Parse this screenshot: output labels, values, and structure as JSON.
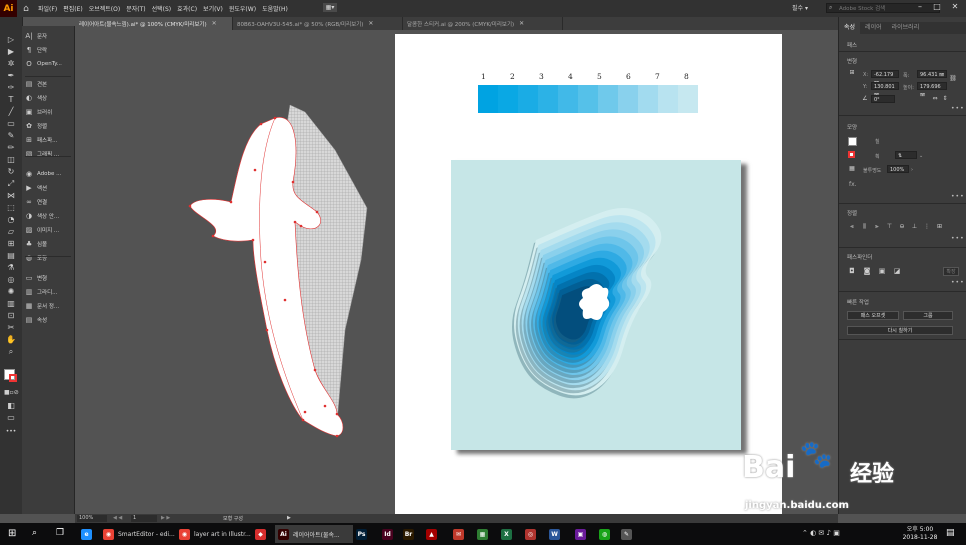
{
  "menubar": {
    "logo": "Ai",
    "items": [
      "파일(F)",
      "편집(E)",
      "오브젝트(O)",
      "문자(T)",
      "선택(S)",
      "효과(C)",
      "보기(V)",
      "윈도우(W)",
      "도움말(H)"
    ],
    "workspace_icon": "▦▾",
    "essentials": "필수 ▾",
    "search_placeholder": "Adobe Stock 검색",
    "window_buttons": [
      "–",
      "□",
      "✕"
    ]
  },
  "tabs": [
    {
      "label": "레이어아트(물속느낌).ai* @ 100% (CMYK/미리보기)",
      "active": true
    },
    {
      "label": "80B63-OAHV3U-545.ai* @ 50% (RGB/미리보기)",
      "active": false
    },
    {
      "label": "달콤한 스티커.ai @ 200% (CMYK/미리보기)",
      "active": false
    }
  ],
  "tab_close": "✕",
  "dock": {
    "items": [
      {
        "icon": "A|",
        "label": "문자"
      },
      {
        "icon": "¶",
        "label": "단락"
      },
      {
        "icon": "O",
        "label": "OpenTy..."
      },
      {
        "icon": "▤",
        "label": "견본"
      },
      {
        "icon": "◐",
        "label": "색상"
      },
      {
        "icon": "▣",
        "label": "브러쉬"
      },
      {
        "icon": "✿",
        "label": "정렬"
      },
      {
        "icon": "⊞",
        "label": "패스파..."
      },
      {
        "icon": "▧",
        "label": "그래픽 ..."
      },
      {
        "icon": "◉",
        "label": "Adobe ..."
      },
      {
        "icon": "▶",
        "label": "액션"
      },
      {
        "icon": "∞",
        "label": "연결"
      },
      {
        "icon": "◑",
        "label": "색상 안..."
      },
      {
        "icon": "▨",
        "label": "이미지 ..."
      },
      {
        "icon": "♣",
        "label": "심볼"
      },
      {
        "icon": "◍",
        "label": "모양"
      },
      {
        "icon": "▭",
        "label": "변형"
      },
      {
        "icon": "▥",
        "label": "그라디..."
      },
      {
        "icon": "▦",
        "label": "문서 정..."
      },
      {
        "icon": "▤",
        "label": "속성"
      }
    ]
  },
  "artboard": {
    "numbers": [
      "1",
      "2",
      "3",
      "4",
      "5",
      "6",
      "7",
      "8"
    ],
    "strip_colors": [
      "#00a3e2",
      "#0aa8e4",
      "#1aace5",
      "#2cb2e6",
      "#41b9e8",
      "#55c1e9",
      "#6fc9eb",
      "#89d1ed",
      "#a2dbef",
      "#b8e3f0",
      "#c6e8f0"
    ],
    "layer_colors": [
      "#d4eef0",
      "#bde5ef",
      "#a4dbee",
      "#8ad0ec",
      "#6ec5ea",
      "#50b9e8",
      "#2eaae3",
      "#119ad9",
      "#0585c6",
      "#0271ad",
      "#025f95",
      "#034e7d"
    ],
    "swatch_bg": "#c6e6e7"
  },
  "right_panel": {
    "tabs": [
      {
        "label": "속성",
        "active": true
      },
      {
        "label": "레이어",
        "active": false
      },
      {
        "label": "라이브러리",
        "active": false
      }
    ],
    "section_path": "패스",
    "section_transform": "변형",
    "x_label": "X:",
    "x_value": "-62.179 ㎜",
    "y_label": "Y:",
    "y_value": "130.801 ㎜",
    "w_label": "폭:",
    "w_value": "96.431 ㎜",
    "h_label": "높이:",
    "h_value": "179.696 ㎜",
    "angle_value": "0°",
    "section_appearance": "모양",
    "fill_label": "칠",
    "stroke_label": "획",
    "opacity_label": "불투명도",
    "opacity_value": "100%",
    "fx": "fx.",
    "section_align": "정렬",
    "section_pathfinder": "패스파인더",
    "expand_label": "확장",
    "section_quick": "빠른 작업",
    "offset_path_button": "패스 오프셋",
    "group_button": "그룹",
    "recolor_button": "다시 칠하기",
    "more": "•••"
  },
  "statusbar": {
    "zoom": "100%",
    "artboard_no": "1",
    "status_label": "모형 구성",
    "nav_prev": "◀ ◀",
    "nav_next": "▶ ▶"
  },
  "taskbar": {
    "apps": [
      {
        "icon": "e",
        "color": "#1e90ff",
        "label": ""
      },
      {
        "icon": "◉",
        "color": "#e94235",
        "label": "SmartEditor - edi..."
      },
      {
        "icon": "◉",
        "color": "#e94235",
        "label": "layer art in Illustr..."
      },
      {
        "icon": "◆",
        "color": "#d62e2e",
        "label": ""
      },
      {
        "icon": "Ai",
        "color": "#330000",
        "label": "레이어아트(물속..."
      },
      {
        "icon": "Ps",
        "color": "#001e36",
        "label": ""
      },
      {
        "icon": "Id",
        "color": "#49021f",
        "label": ""
      },
      {
        "icon": "Br",
        "color": "#2b1a00",
        "label": ""
      },
      {
        "icon": "▲",
        "color": "#a40000",
        "label": ""
      },
      {
        "icon": "✉",
        "color": "#c0392b",
        "label": ""
      },
      {
        "icon": "▦",
        "color": "#2e7d32",
        "label": ""
      },
      {
        "icon": "X",
        "color": "#1d6f42",
        "label": ""
      },
      {
        "icon": "◎",
        "color": "#b0342f",
        "label": ""
      },
      {
        "icon": "W",
        "color": "#2b579a",
        "label": ""
      },
      {
        "icon": "▣",
        "color": "#6a1b9a",
        "label": ""
      },
      {
        "icon": "◍",
        "color": "#19a319",
        "label": ""
      },
      {
        "icon": "✎",
        "color": "#555555",
        "label": ""
      }
    ],
    "clock_time": "오후 5:00",
    "clock_date": "2018-11-28"
  },
  "watermark": {
    "text1": "Bai",
    "text2": "经验",
    "url": "jingyan.baidu.com"
  }
}
